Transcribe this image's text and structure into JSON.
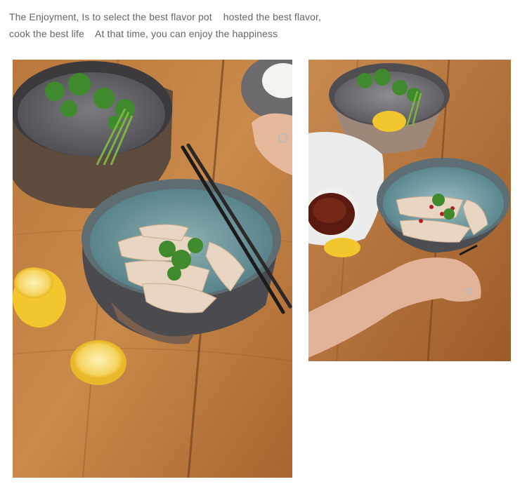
{
  "caption": {
    "line1": "The Enjoyment, Is to select the best flavor pot    hosted the best flavor,",
    "line2": "cook the best life    At that time, you can enjoy the happiness"
  },
  "colors": {
    "wood_light": "#c98a4a",
    "wood_dark": "#8a4f22",
    "bowl_outer": "#5a5a5e",
    "bowl_inner_teal": "#4f7f86",
    "lemon": "#f2c72e",
    "cilantro": "#3f8a2c"
  }
}
